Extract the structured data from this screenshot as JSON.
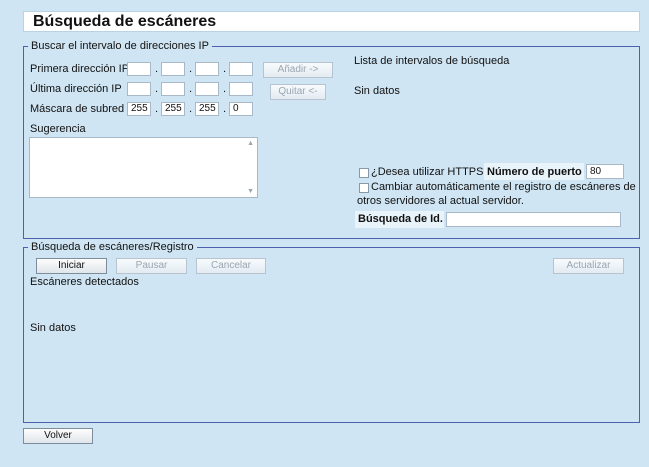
{
  "title": "Búsqueda de escáneres",
  "ip_group": {
    "legend": "Buscar el intervalo de direcciones IP",
    "first_ip_label": "Primera dirección IP",
    "last_ip_label": "Última dirección IP",
    "mask_label": "Máscara de subred",
    "mask_values": [
      "255",
      "255",
      "255",
      "0"
    ],
    "add_button": "Añadir ->",
    "remove_button": "Quitar <-",
    "range_list_label": "Lista de intervalos de búsqueda",
    "range_list_empty": "Sin datos",
    "hint_label": "Sugerencia",
    "https_label": "¿Desea utilizar HTTPS?",
    "port_label": "Número de puerto",
    "port_value": "80",
    "auto_change_label_line1": "Cambiar automáticamente el registro de escáneres de",
    "auto_change_label_line2": "otros servidores al actual servidor.",
    "id_search_label": "Búsqueda de Id."
  },
  "scan_group": {
    "legend": "Búsqueda de escáneres/Registro",
    "start_button": "Iniciar",
    "pause_button": "Pausar",
    "cancel_button": "Cancelar",
    "update_button": "Actualizar",
    "detected_label": "Escáneres detectados",
    "empty_text": "Sin datos"
  },
  "back_button": "Volver"
}
